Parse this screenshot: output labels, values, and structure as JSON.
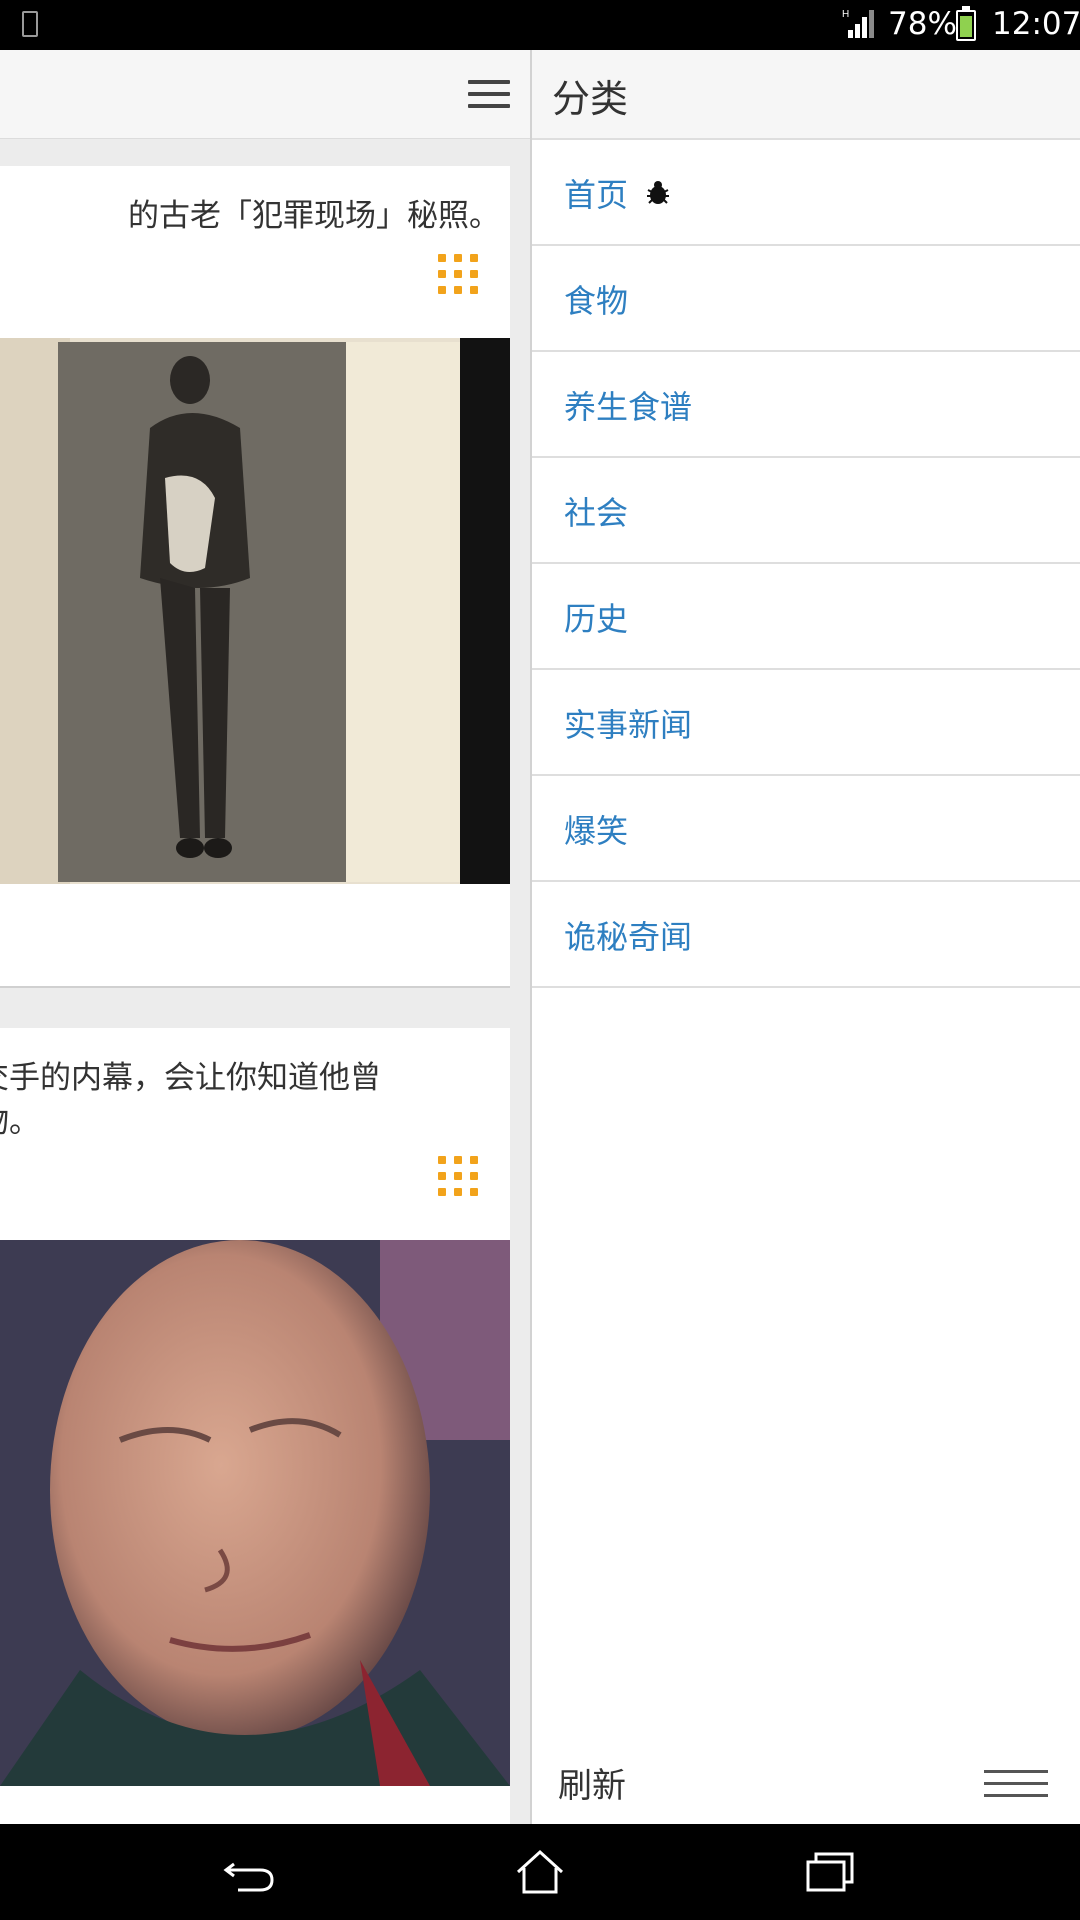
{
  "status_bar": {
    "battery_percent": "78%",
    "time": "12:07",
    "network_type": "H",
    "battery_level": 0.78
  },
  "feed": {
    "menu_icon": "hamburger-menu-icon",
    "cards": [
      {
        "text": "的古老「犯罪现场」秘照。",
        "more_icon": "grid-dots-icon"
      },
      {
        "text": "交手的内幕，会让你知道他曾\n物。",
        "more_icon": "grid-dots-icon"
      }
    ]
  },
  "drawer": {
    "title": "分类",
    "items": [
      {
        "label": "首页",
        "icon": "bug-icon"
      },
      {
        "label": "食物"
      },
      {
        "label": "养生食谱"
      },
      {
        "label": "社会"
      },
      {
        "label": "历史"
      },
      {
        "label": "实事新闻"
      },
      {
        "label": "爆笑"
      },
      {
        "label": "诡秘奇闻"
      }
    ],
    "footer": {
      "refresh_label": "刷新",
      "menu_icon": "hamburger-menu-icon"
    }
  },
  "nav_bar": {
    "buttons": [
      "back-icon",
      "home-icon",
      "recents-icon"
    ]
  },
  "colors": {
    "link_blue": "#2e7fc1",
    "accent_orange": "#f2a31b",
    "status_bar_bg": "#000000"
  }
}
